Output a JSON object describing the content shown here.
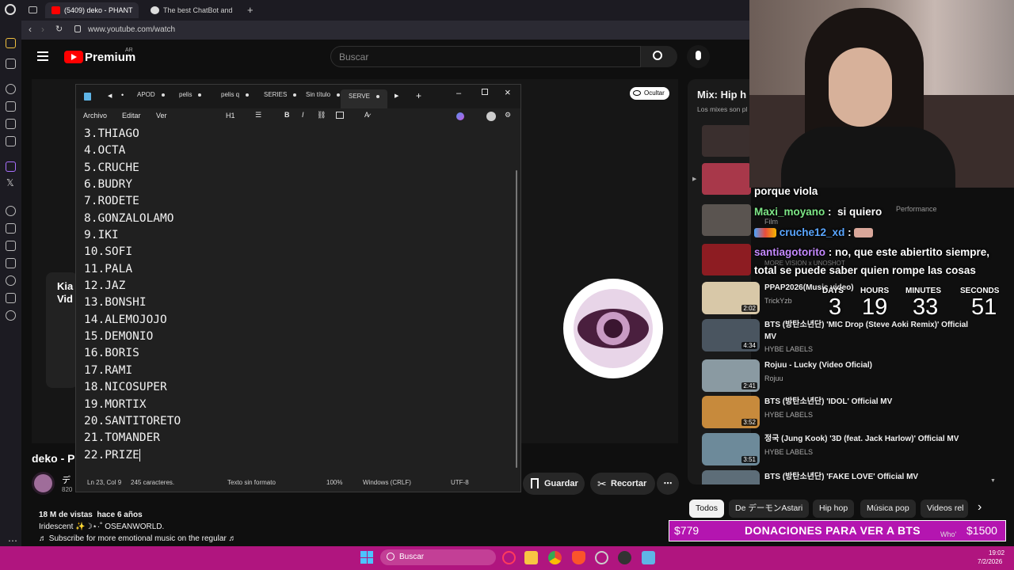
{
  "browser": {
    "tabs": [
      {
        "label": "(5409) deko - PHANT",
        "active": true
      },
      {
        "label": "The best ChatBot and",
        "active": false
      }
    ],
    "url": "www.youtube.com/watch"
  },
  "youtube": {
    "logo_text": "Premium",
    "region": "AR",
    "search_placeholder": "Buscar",
    "hide_button": "Ocultar",
    "mix_title": "Mix: Hip h",
    "mix_sub": "Los mixes son pl",
    "video_title": "deko - P",
    "channel_initial": "デ",
    "subs": "820",
    "save_label": "Guardar",
    "clip_label": "Recortar",
    "views": "18 M de vistas",
    "age": "hace 6 años",
    "desc_line1": "Iridescent ✨☽⋆·˚ OSEANWORLD.",
    "desc_line2": "♬ Subscribe for more emotional music on the regular ♬",
    "left_card": "Kia\nVid",
    "recommendations": [
      {
        "title": "PPAP2026(Music video)",
        "channel": "TrickYzb",
        "duration": "2:02"
      },
      {
        "title": "BTS (방탄소년단) 'MIC Drop (Steve Aoki Remix)' Official MV",
        "channel": "HYBE LABELS",
        "duration": "4:34"
      },
      {
        "title": "Rojuu - Lucky (Video Oficial)",
        "channel": "Rojuu",
        "duration": "2:41"
      },
      {
        "title": "BTS (방탄소년단) 'IDOL' Official MV",
        "channel": "HYBE LABELS",
        "duration": "3:52"
      },
      {
        "title": "정국 (Jung Kook) '3D (feat. Jack Harlow)' Official MV",
        "channel": "HYBE LABELS",
        "duration": "3:51"
      },
      {
        "title": "BTS (방탄소년단) 'FAKE LOVE' Official MV",
        "channel": "",
        "duration": ""
      }
    ],
    "hidden_rec_fragments": [
      "Performance",
      "Film",
      "MORE VISION x UNOSHOT"
    ],
    "chips": [
      "Todos",
      "De デーモンAstari",
      "Hip hop",
      "Música pop",
      "Videos rel"
    ]
  },
  "notepad": {
    "tabs": [
      "APOD",
      "pelis",
      "pelis q",
      "SERIES",
      "Sin título",
      "SERVE"
    ],
    "menu": [
      "Archivo",
      "Editar",
      "Ver"
    ],
    "heading": "H1",
    "lines": [
      "3.THIAGO",
      "4.OCTA",
      "5.CRUCHE",
      "6.BUDRY",
      "7.RODETE",
      "8.GONZALOLAMO",
      "9.IKI",
      "10.SOFI",
      "11.PALA",
      "12.JAZ",
      "13.BONSHI",
      "14.ALEMOJOJO",
      "15.DEMONIO",
      "16.BORIS",
      "17.RAMI",
      "18.NICOSUPER",
      "19.MORTIX",
      "20.SANTITORETO",
      "21.TOMANDER",
      "22.PRIZE"
    ],
    "status": {
      "position": "Ln 23, Col 9",
      "chars": "245 caracteres.",
      "format": "Texto sin formato",
      "zoom": "100%",
      "eol": "Windows (CRLF)",
      "encoding": "UTF-8"
    }
  },
  "stream": {
    "chat": [
      {
        "user": "",
        "text": "porque viola"
      },
      {
        "user": "Maxi_moyano",
        "text": "si quiero"
      },
      {
        "user": "cruche12_xd",
        "text": ""
      },
      {
        "user": "santiagotorito",
        "text": "no, que este abiertito siempre,"
      },
      {
        "user": "",
        "text": "total se puede saber quien rompe las cosas"
      }
    ],
    "countdown": {
      "labels": [
        "DAYS",
        "HOURS",
        "MINUTES",
        "SECONDS"
      ],
      "values": [
        "3",
        "19",
        "33",
        "51"
      ]
    },
    "donation": {
      "left": "$779",
      "center": "DONACIONES PARA VER A BTS",
      "right": "$1500"
    },
    "overlay_fragment": "Who'"
  },
  "taskbar": {
    "search": "Buscar",
    "time": "19:02",
    "date": "7/2/2026"
  },
  "colors": {
    "youtube_red": "#ff0000",
    "taskbar": "#b0157f",
    "donation_bar": "#b415b0",
    "chat_user_green": "#7ee787",
    "chat_user_blue": "#5aa6ff",
    "chat_user_purple": "#c58aff"
  }
}
